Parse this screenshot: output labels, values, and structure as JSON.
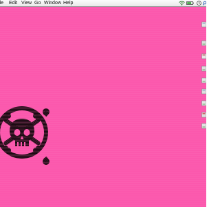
{
  "menubar": {
    "items": [
      "ile",
      "Edit",
      "View",
      "Go",
      "Window",
      "Help"
    ]
  },
  "status": {
    "icons": [
      "wifi-icon",
      "battery-icon",
      "clock-icon",
      "search-icon"
    ]
  },
  "desktop": {
    "background_color": "#fb58ad",
    "icons": [
      "drive-icon",
      "drive-icon",
      "drive-icon",
      "drive-icon",
      "drive-icon",
      "drive-icon",
      "drive-icon",
      "drive-icon",
      "drive-icon"
    ],
    "wallpaper_emblem": "skull-and-crossbones-icon"
  }
}
